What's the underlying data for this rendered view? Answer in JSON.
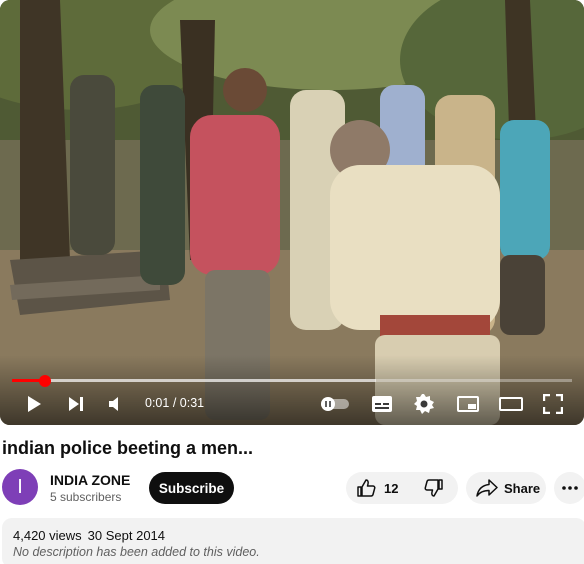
{
  "player": {
    "current_time": "0:01",
    "separator": " / ",
    "duration": "0:31",
    "progress_fraction": 0.059,
    "buffered_fraction": 0.65
  },
  "video": {
    "title": "indian police beeting a men..."
  },
  "channel": {
    "avatar_letter": "I",
    "avatar_color": "#7e3fb7",
    "name": "INDIA ZONE",
    "subscribers": "5 subscribers",
    "subscribe_label": "Subscribe"
  },
  "actions": {
    "like_count": "12",
    "share_label": "Share"
  },
  "description": {
    "views": "4,420 views",
    "date": "30 Sept 2014",
    "text": "No description has been added to this video."
  },
  "colors": {
    "accent_red": "#ff0000",
    "pill_bg": "#f2f2f2"
  },
  "icons": [
    "play-icon",
    "next-icon",
    "volume-icon",
    "autoplay-toggle-icon",
    "subtitles-icon",
    "settings-icon",
    "miniplayer-icon",
    "theater-icon",
    "fullscreen-icon",
    "like-icon",
    "dislike-icon",
    "share-icon",
    "more-icon"
  ]
}
